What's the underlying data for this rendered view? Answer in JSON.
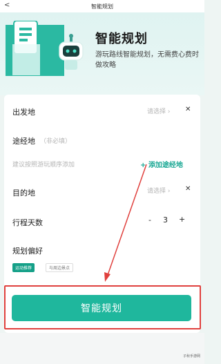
{
  "topbar": {
    "back_glyph": "<",
    "title": "智能规划"
  },
  "hero": {
    "title": "智能规划",
    "subtitle": "游玩路线智能规划，无需费心费时做攻略"
  },
  "form": {
    "departure": {
      "label": "出发地",
      "hint": "请选择 ›",
      "close": "✕"
    },
    "waypoint": {
      "label": "途经地",
      "optional": "（非必填）",
      "hint": "建议按照游玩顺序添加",
      "add_label": "+ 添加途经地"
    },
    "destination": {
      "label": "目的地",
      "hint": "请选择 ›",
      "close": "✕"
    },
    "days": {
      "label": "行程天数",
      "minus": "-",
      "value": "3",
      "plus": "+"
    },
    "preference": {
      "label": "规划偏好",
      "tags": [
        "运动推荐",
        "与周边景点"
      ]
    }
  },
  "plan_button": {
    "label": "智能规划"
  },
  "watermark": "子秋手游网",
  "colors": {
    "accent": "#1fb79d",
    "highlight": "#e0403d",
    "link": "#1aa894"
  }
}
